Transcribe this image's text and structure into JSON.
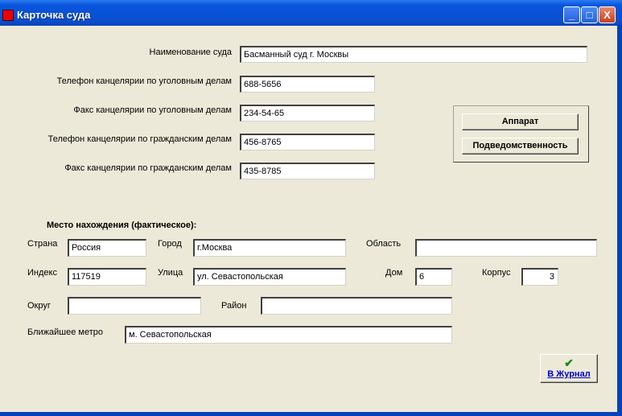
{
  "window": {
    "title": "Карточка суда",
    "minimize": "_",
    "maximize": "□",
    "close": "X"
  },
  "court": {
    "name_label": "Наименование суда",
    "name": "Басманный суд г. Москвы",
    "phone_criminal_label": "Телефон канцелярии по уголовным делам",
    "phone_criminal": "688-5656",
    "fax_criminal_label": "Факс канцелярии по уголовным делам",
    "fax_criminal": "234-54-65",
    "phone_civil_label": "Телефон канцелярии по гражданским делам",
    "phone_civil": "456-8765",
    "fax_civil_label": "Факс канцелярии по гражданским делам",
    "fax_civil": "435-8785"
  },
  "buttons": {
    "apparat": "Аппарат",
    "subordination": "Подведомственность",
    "journal": "В Журнал",
    "journal_icon": "✔"
  },
  "location": {
    "heading": "Место нахождения (фактическое):",
    "country_label": "Страна",
    "country": "Россия",
    "city_label": "Город",
    "city": "г.Москва",
    "region_label": "Область",
    "region": "",
    "index_label": "Индекс",
    "index": "117519",
    "street_label": "Улица",
    "street": "ул. Севастопольская",
    "house_label": "Дом",
    "house": "6",
    "building_label": "Корпус",
    "building": "3",
    "district_label": "Округ",
    "district": "",
    "area_label": "Район",
    "area": "",
    "metro_label": "Ближайшее метро",
    "metro": "м. Севастопольская"
  }
}
